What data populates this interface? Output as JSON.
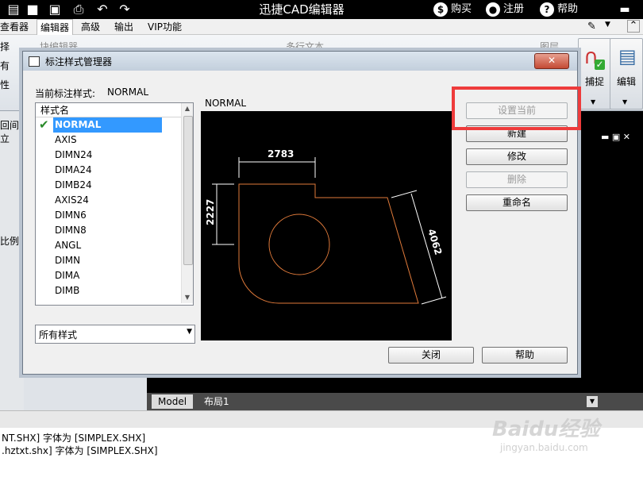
{
  "app": {
    "title": "迅捷CAD编辑器",
    "right_items": {
      "buy": "购买",
      "register": "注册",
      "help": "帮助"
    }
  },
  "menu": [
    "查看器",
    "编辑器",
    "高级",
    "输出",
    "VIP功能"
  ],
  "menu_active_index": 1,
  "ribbon": {
    "snap": "捕捉",
    "edit": "编辑",
    "faded_block": "块编辑器",
    "faded_text": "多行文本",
    "faded_layer": "图层",
    "left_fragments": [
      "择",
      "有",
      "性",
      "回间立",
      "比例"
    ]
  },
  "dialog": {
    "title": "标注样式管理器",
    "close_symbol": "✕",
    "current_label": "当前标注样式:",
    "current_value": "NORMAL",
    "list_header": "样式名",
    "styles": [
      "NORMAL",
      "AXIS",
      "DIMN24",
      "DIMA24",
      "DIMB24",
      "AXIS24",
      "DIMN6",
      "DIMN8",
      "ANGL",
      "DIMN",
      "DIMA",
      "DIMB"
    ],
    "selected_index": 0,
    "filter_value": "所有样式",
    "preview_label": "NORMAL",
    "preview_dims": {
      "top": "2783",
      "left": "2227",
      "right": "4062"
    },
    "buttons": {
      "set_current": "设置当前",
      "new": "新建",
      "modify": "修改",
      "delete": "删除",
      "rename": "重命名",
      "close": "关闭",
      "help": "帮助"
    }
  },
  "tabs": [
    "Model",
    "布局1"
  ],
  "command_lines": [
    "NT.SHX] 字体为 [SIMPLEX.SHX]",
    ".hztxt.shx] 字体为 [SIMPLEX.SHX]"
  ],
  "watermark": {
    "brand": "Baidu经验",
    "url": "jingyan.baidu.com"
  },
  "colors": {
    "highlight": "#ee3b3b",
    "selection": "#3399ff",
    "preview_geometry": "#e07a3a"
  }
}
